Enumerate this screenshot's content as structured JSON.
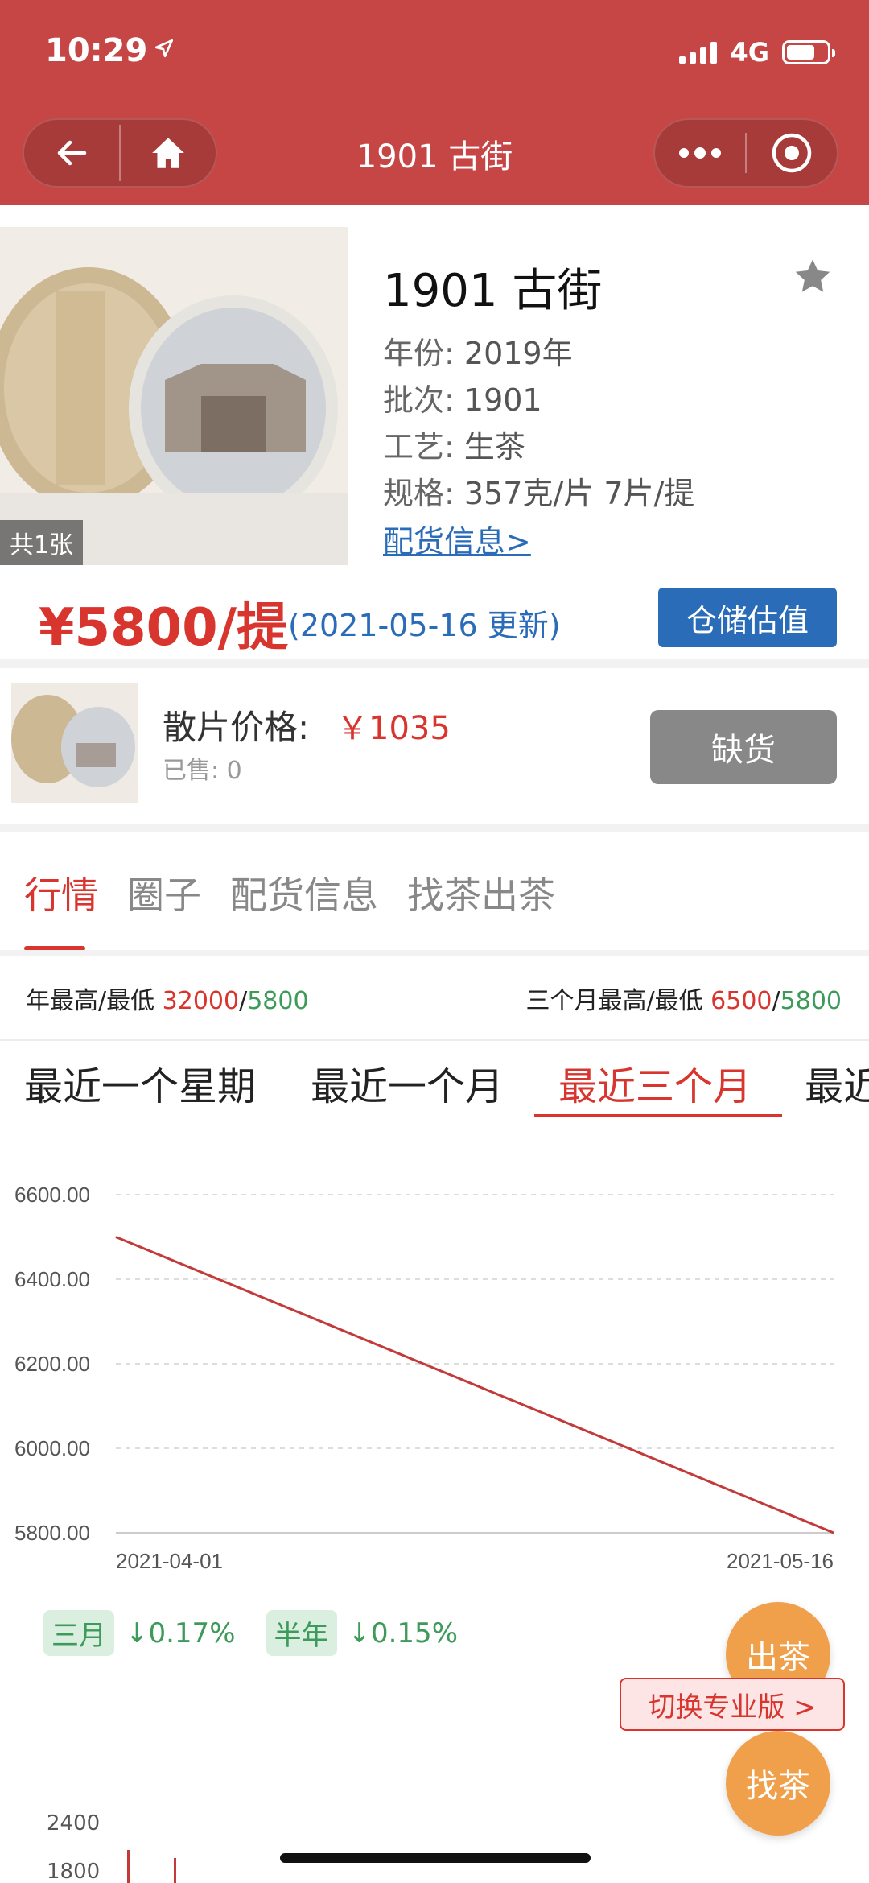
{
  "status": {
    "time": "10:29",
    "network": "4G"
  },
  "nav": {
    "title": "1901 古街",
    "back_icon": "arrow-left-icon",
    "home_icon": "home-icon",
    "more_icon": "more-dots-icon",
    "close_icon": "target-circle-icon"
  },
  "product": {
    "title": "1901 古街",
    "image_count": "共1张",
    "year_label": "年份:",
    "year": "2019年",
    "batch_label": "批次:",
    "batch": "1901",
    "craft_label": "工艺:",
    "craft": "生茶",
    "spec_label": "规格:",
    "spec": "357克/片 7片/提",
    "alloc_link": "配货信息>",
    "price": "¥5800/提",
    "price_date": "(2021-05-16 更新)",
    "valuation_button": "仓储估值"
  },
  "loose": {
    "label": "散片价格:",
    "price": "￥1035",
    "sold": "已售: 0",
    "soldout_button": "缺货"
  },
  "tabs": [
    "行情",
    "圈子",
    "配货信息",
    "找茶出茶"
  ],
  "stats": {
    "year_label": "年最高/最低",
    "year_high": "32000",
    "slash": "/",
    "year_low": "5800",
    "three_month_label": "三个月最高/最低",
    "three_month_high": "6500",
    "three_month_low": "5800"
  },
  "range_tabs": [
    "最近一个星期",
    "最近一个月",
    "最近三个月",
    "最近"
  ],
  "chart_data": {
    "type": "line",
    "x": [
      "2021-04-01",
      "2021-05-16"
    ],
    "series": [
      {
        "values": [
          6500,
          5800
        ]
      }
    ],
    "yticks": [
      "6600.00",
      "6400.00",
      "6200.00",
      "6000.00",
      "5800.00"
    ],
    "ylim": [
      5800,
      6600
    ],
    "grid": true,
    "color": "#c23a3a"
  },
  "pct": {
    "three_month_label": "三月",
    "three_month_value": "↓0.17%",
    "half_year_label": "半年",
    "half_year_value": "↓0.15%"
  },
  "fab": {
    "sell": "出茶",
    "find": "找茶",
    "switch_pro": "切换专业版 >"
  },
  "bottom_axis": {
    "tick_top": "2400",
    "tick_bottom": "1800"
  },
  "colors": {
    "brand_red": "#c54644",
    "price_red": "#d8352f",
    "link_blue": "#2a6cb8",
    "up_green": "#3e9a5a",
    "fab_orange": "#f0a04b"
  }
}
